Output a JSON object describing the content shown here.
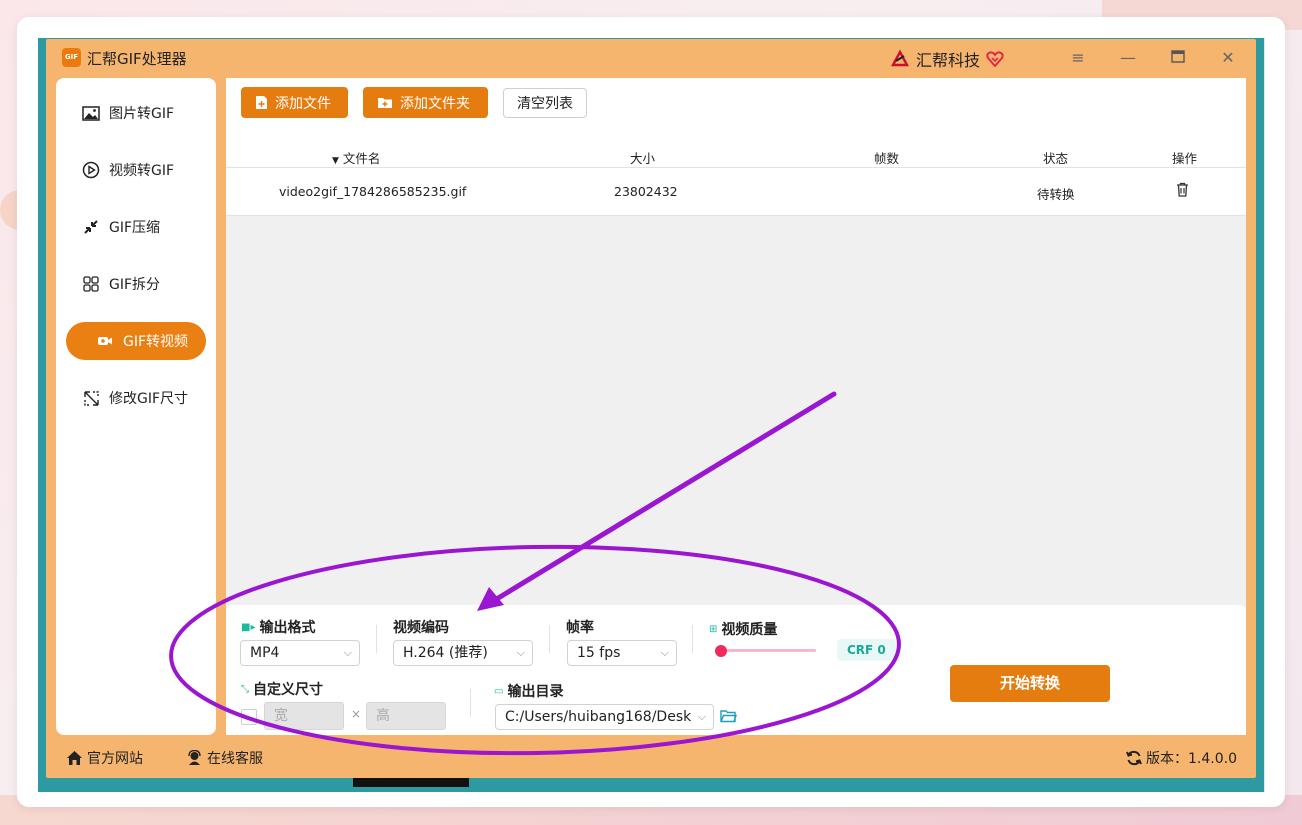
{
  "app": {
    "title": "汇帮GIF处理器",
    "logo_text": "GIF",
    "brand": "汇帮科技",
    "window_controls": [
      "menu-icon",
      "minimize-icon",
      "maximize-icon",
      "close-icon"
    ],
    "accent_color": "#e57c10",
    "frame_color": "#f6b56e"
  },
  "sidebar": {
    "items": [
      {
        "label": "图片转GIF",
        "icon": "image-icon",
        "active": false
      },
      {
        "label": "视频转GIF",
        "icon": "play-circle-icon",
        "active": false
      },
      {
        "label": "GIF压缩",
        "icon": "compress-icon",
        "active": false
      },
      {
        "label": "GIF拆分",
        "icon": "split-icon",
        "active": false
      },
      {
        "label": "GIF转视频",
        "icon": "video-camera-icon",
        "active": true
      },
      {
        "label": "修改GIF尺寸",
        "icon": "resize-icon",
        "active": false
      }
    ]
  },
  "toolbar": {
    "add_file": "添加文件",
    "add_folder": "添加文件夹",
    "clear_list": "清空列表"
  },
  "table": {
    "headers": {
      "filename": "文件名",
      "size": "大小",
      "frames": "帧数",
      "status": "状态",
      "action": "操作"
    },
    "rows": [
      {
        "filename": "video2gif_1784286585235.gif",
        "size": "23802432",
        "frames": "",
        "status": "待转换",
        "action_icon": "trash-icon"
      }
    ]
  },
  "settings": {
    "output_format_label": "输出格式",
    "output_format_value": "MP4",
    "video_codec_label": "视频编码",
    "video_codec_value": "H.264 (推荐)",
    "frame_rate_label": "帧率",
    "frame_rate_value": "15 fps",
    "quality_label": "视频质量",
    "quality_value": "CRF 0",
    "quality_level": 0,
    "custom_size_label": "自定义尺寸",
    "width_placeholder": "宽",
    "height_placeholder": "高",
    "size_separator": "×",
    "output_dir_label": "输出目录",
    "output_dir_value": "C:/Users/huibang168/Desk",
    "start_button": "开始转换"
  },
  "footer": {
    "website": "官方网站",
    "support": "在线客服",
    "version": "版本：1.4.0.0"
  },
  "annotation": {
    "color": "#9b16d0",
    "shapes": [
      "arrow",
      "ellipse"
    ]
  }
}
